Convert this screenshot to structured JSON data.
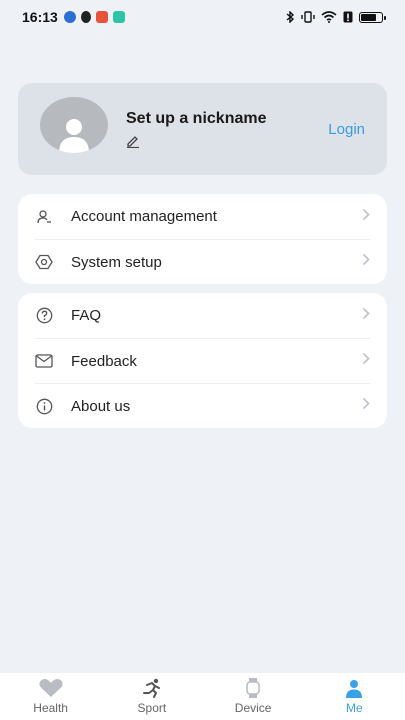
{
  "status_bar": {
    "time": "16:13",
    "colors": {
      "bg": "#eef2f7"
    }
  },
  "profile": {
    "nickname": "Set up a nickname",
    "login_label": "Login",
    "edit_icon": "pencil-icon",
    "avatar_icon": "user-silhouette-icon"
  },
  "menu_group_1": [
    {
      "label": "Account management",
      "icon": "account-icon"
    },
    {
      "label": "System setup",
      "icon": "gear-icon"
    }
  ],
  "menu_group_2": [
    {
      "label": "FAQ",
      "icon": "question-icon"
    },
    {
      "label": "Feedback",
      "icon": "mail-icon"
    },
    {
      "label": "About us",
      "icon": "info-icon"
    }
  ],
  "bottom_nav": {
    "tabs": [
      {
        "label": "Health",
        "icon": "heart-icon"
      },
      {
        "label": "Sport",
        "icon": "runner-icon"
      },
      {
        "label": "Device",
        "icon": "watch-icon"
      },
      {
        "label": "Me",
        "icon": "person-icon"
      }
    ],
    "active_index": 3
  },
  "colors": {
    "accent": "#3a9be0",
    "card": "#ffffff",
    "profile_card": "#dde1e8",
    "page_bg": "#eef2f7"
  }
}
